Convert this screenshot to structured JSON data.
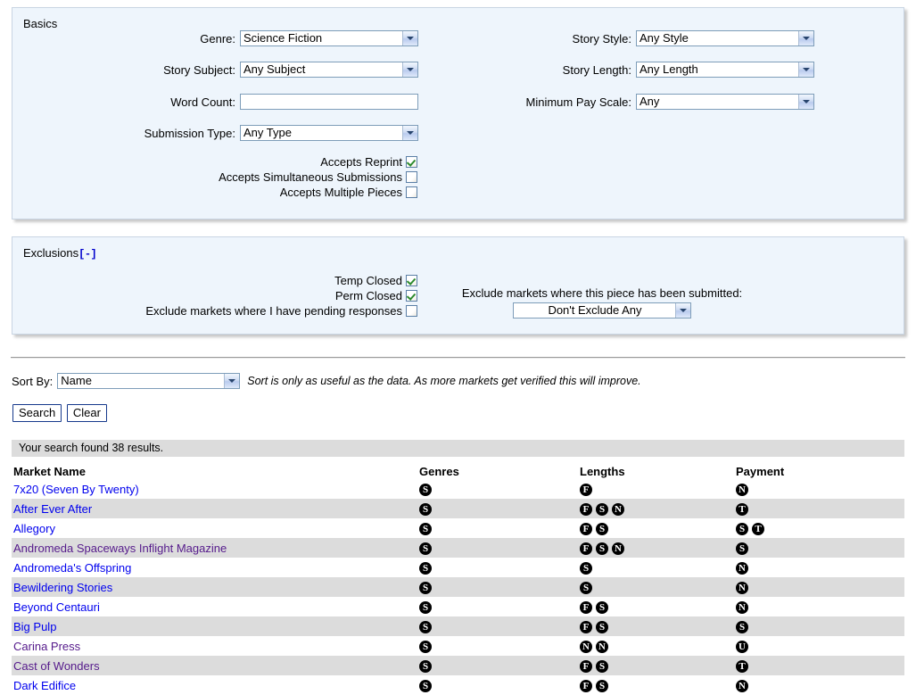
{
  "basics": {
    "legend": "Basics",
    "left_fields": [
      {
        "label": "Genre:",
        "value": "Science Fiction",
        "type": "select"
      },
      {
        "label": "Story Subject:",
        "value": "Any Subject",
        "type": "select"
      },
      {
        "label": "Word Count:",
        "value": "",
        "placeholder": "",
        "type": "text"
      },
      {
        "label": "Submission Type:",
        "value": "Any Type",
        "type": "select"
      }
    ],
    "right_fields": [
      {
        "label": "Story Style:",
        "value": "Any Style",
        "type": "select"
      },
      {
        "label": "Story Length:",
        "value": "Any Length",
        "type": "select"
      },
      {
        "label": "Minimum Pay Scale:",
        "value": "Any",
        "type": "select"
      }
    ],
    "checkboxes": [
      {
        "label": "Accepts Reprint",
        "checked": true
      },
      {
        "label": "Accepts Simultaneous Submissions",
        "checked": false
      },
      {
        "label": "Accepts Multiple Pieces",
        "checked": false
      }
    ]
  },
  "exclusions": {
    "legend": "Exclusions",
    "toggle": "[-]",
    "checkboxes": [
      {
        "label": "Temp Closed",
        "checked": true
      },
      {
        "label": "Perm Closed",
        "checked": true
      },
      {
        "label": "Exclude markets where I have pending responses",
        "checked": false
      }
    ],
    "submitted_label": "Exclude markets where this piece has been submitted:",
    "submitted_value": "Don't Exclude Any"
  },
  "sort": {
    "label": "Sort By:",
    "value": "Name",
    "hint": "Sort is only as useful as the data. As more markets get verified this will improve."
  },
  "actions": {
    "search_label": "Search",
    "clear_label": "Clear"
  },
  "results": {
    "banner": "Your search found 38 results.",
    "columns": [
      "Market Name",
      "Genres",
      "Lengths",
      "Payment"
    ],
    "rows": [
      {
        "name": "7x20 (Seven By Twenty)",
        "visited": false,
        "genres": [
          "S"
        ],
        "lengths": [
          "F"
        ],
        "payment": [
          "N"
        ]
      },
      {
        "name": "After Ever After",
        "visited": false,
        "genres": [
          "S"
        ],
        "lengths": [
          "F",
          "S",
          "N"
        ],
        "payment": [
          "T"
        ]
      },
      {
        "name": "Allegory",
        "visited": false,
        "genres": [
          "S"
        ],
        "lengths": [
          "F",
          "S"
        ],
        "payment": [
          "S",
          "T"
        ]
      },
      {
        "name": "Andromeda Spaceways Inflight Magazine",
        "visited": true,
        "genres": [
          "S"
        ],
        "lengths": [
          "F",
          "S",
          "N"
        ],
        "payment": [
          "S"
        ]
      },
      {
        "name": "Andromeda's Offspring",
        "visited": false,
        "genres": [
          "S"
        ],
        "lengths": [
          "S"
        ],
        "payment": [
          "N"
        ]
      },
      {
        "name": "Bewildering Stories",
        "visited": false,
        "genres": [
          "S"
        ],
        "lengths": [
          "S"
        ],
        "payment": [
          "N"
        ]
      },
      {
        "name": "Beyond Centauri",
        "visited": false,
        "genres": [
          "S"
        ],
        "lengths": [
          "F",
          "S"
        ],
        "payment": [
          "N"
        ]
      },
      {
        "name": "Big Pulp",
        "visited": false,
        "genres": [
          "S"
        ],
        "lengths": [
          "F",
          "S"
        ],
        "payment": [
          "S"
        ]
      },
      {
        "name": "Carina Press",
        "visited": true,
        "genres": [
          "S"
        ],
        "lengths": [
          "N",
          "N"
        ],
        "payment": [
          "U"
        ]
      },
      {
        "name": "Cast of Wonders",
        "visited": true,
        "genres": [
          "S"
        ],
        "lengths": [
          "F",
          "S"
        ],
        "payment": [
          "T"
        ]
      },
      {
        "name": "Dark Edifice",
        "visited": false,
        "genres": [
          "S"
        ],
        "lengths": [
          "F",
          "S"
        ],
        "payment": [
          "N"
        ]
      }
    ]
  },
  "colors": {
    "panel_bg": "#eef5fc",
    "panel_border": "#c9d5e3",
    "link": "#0000ee",
    "link_visited": "#551a8b",
    "row_alt": "#dcdcdc",
    "banner_bg": "#dcdcdc",
    "badge_bg": "#000000"
  }
}
